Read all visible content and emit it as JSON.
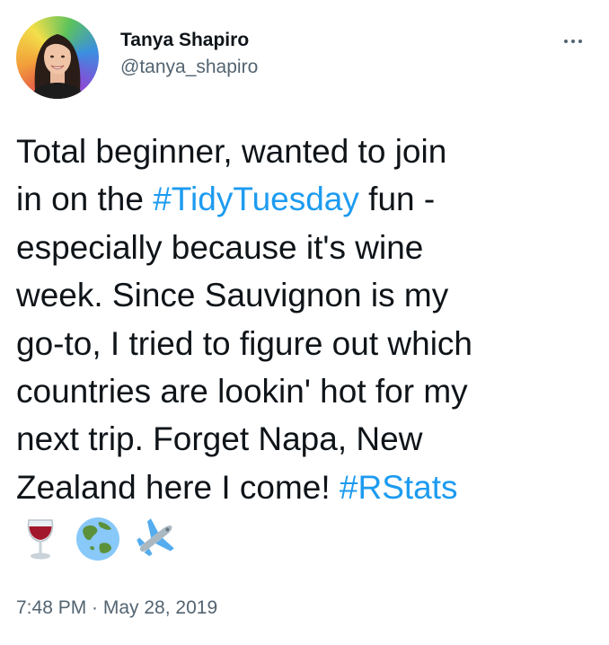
{
  "author": {
    "display_name": "Tanya Shapiro",
    "handle": "@tanya_shapiro"
  },
  "tweet": {
    "lines": [
      [
        {
          "text": "Total beginner, wanted to join"
        }
      ],
      [
        {
          "text": "in on the "
        },
        {
          "text": "#TidyTuesday",
          "hashtag": true
        },
        {
          "text": " fun -"
        }
      ],
      [
        {
          "text": "especially because it's wine"
        }
      ],
      [
        {
          "text": "week. Since Sauvignon is my"
        }
      ],
      [
        {
          "text": "go-to, I tried to figure out which"
        }
      ],
      [
        {
          "text": "countries are lookin' hot for my"
        }
      ],
      [
        {
          "text": "next trip. Forget Napa, New"
        }
      ],
      [
        {
          "text": "Zealand here I come! "
        },
        {
          "text": "#RStats",
          "hashtag": true
        }
      ]
    ],
    "emojis": [
      "wine-glass",
      "globe-asia-australia",
      "airplane"
    ],
    "timestamp": "7:48 PM · May 28, 2019"
  },
  "colors": {
    "text": "#0f1419",
    "secondary": "#536471",
    "hashtag": "#1d9bf0",
    "background": "#ffffff"
  },
  "icons": {
    "more": "more-horizontal-icon"
  }
}
